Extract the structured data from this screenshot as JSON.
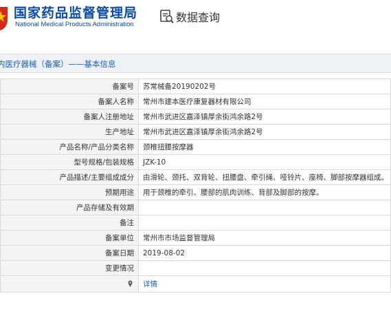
{
  "header": {
    "agency_cn": "国家药品监督管理局",
    "agency_en": "National Medical Products Administration",
    "query_title": "数据查询"
  },
  "section": {
    "title": "内医疗器械（备案）——基本信息"
  },
  "rows": [
    {
      "label": "备案号",
      "value": "苏常械备20190202号"
    },
    {
      "label": "备案人名称",
      "value": "常州市建本医疗康复器材有限公司"
    },
    {
      "label": "备案人注册地址",
      "value": "常州市武进区嘉泽镇厚余街鸿余路2号"
    },
    {
      "label": "生产地址",
      "value": "常州市武进区嘉泽镇厚余街鸿余路2号"
    },
    {
      "label": "产品名称/产品分类名称",
      "value": "颈椎扭腰按摩器"
    },
    {
      "label": "型号规格/包装规格",
      "value": "JZK-10"
    },
    {
      "label": "产品描述/主要组成成分",
      "value": "由滑轮、颈托、双背轮、扭腰盘、牵引绳、哑铃片、座椅、脚部按摩器组成。"
    },
    {
      "label": "预期用途",
      "value": "用于颈椎的牵引、腰部的肌肉训练、背部及脚部的按摩。"
    },
    {
      "label": "产品存储及有效期",
      "value": ""
    },
    {
      "label": "备注",
      "value": ""
    },
    {
      "label": "备案单位",
      "value": "常州市市场监督管理局"
    },
    {
      "label": "备案日期",
      "value": "2019-08-02"
    },
    {
      "label": "变更情况",
      "value": ""
    },
    {
      "label": "",
      "value": ""
    }
  ],
  "detail_link": "详情",
  "colors": {
    "brand_blue": "#0b4a9e",
    "emblem_red": "#d42a1e",
    "link_blue": "#1a5fb4"
  },
  "icons": {
    "emblem": "national-emblem-icon",
    "query": "document-search-icon",
    "pin": "location-pin-icon"
  }
}
